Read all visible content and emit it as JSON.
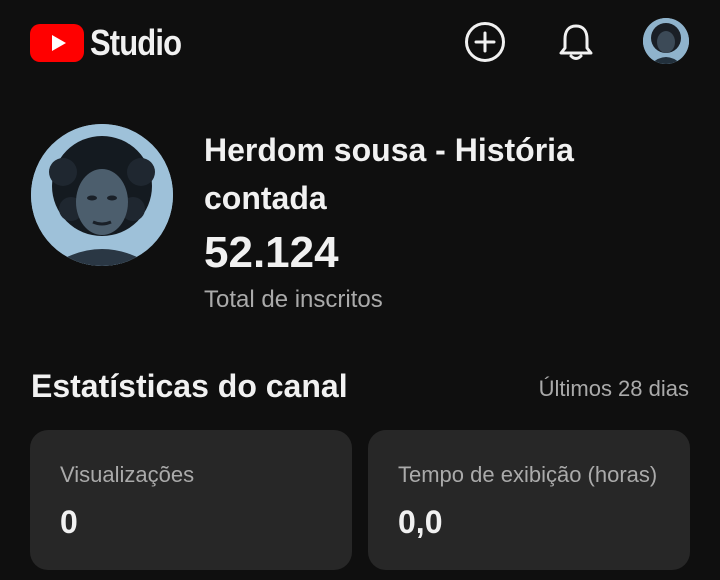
{
  "header": {
    "app_name": "Studio",
    "icons": [
      "create-icon",
      "notifications-icon",
      "account-avatar"
    ]
  },
  "channel": {
    "name": "Herdom sousa - História contada",
    "subscriber_count": "52.124",
    "subscriber_label": "Total de inscritos"
  },
  "stats": {
    "title": "Estatísticas do canal",
    "period": "Últimos 28 dias",
    "cards": [
      {
        "label": "Visualizações",
        "value": "0"
      },
      {
        "label": "Tempo de exibição (horas)",
        "value": "0,0"
      }
    ]
  },
  "colors": {
    "background": "#0f0f0f",
    "card": "#272727",
    "brand_red": "#ff0000",
    "secondary_text": "#aaaaaa"
  }
}
